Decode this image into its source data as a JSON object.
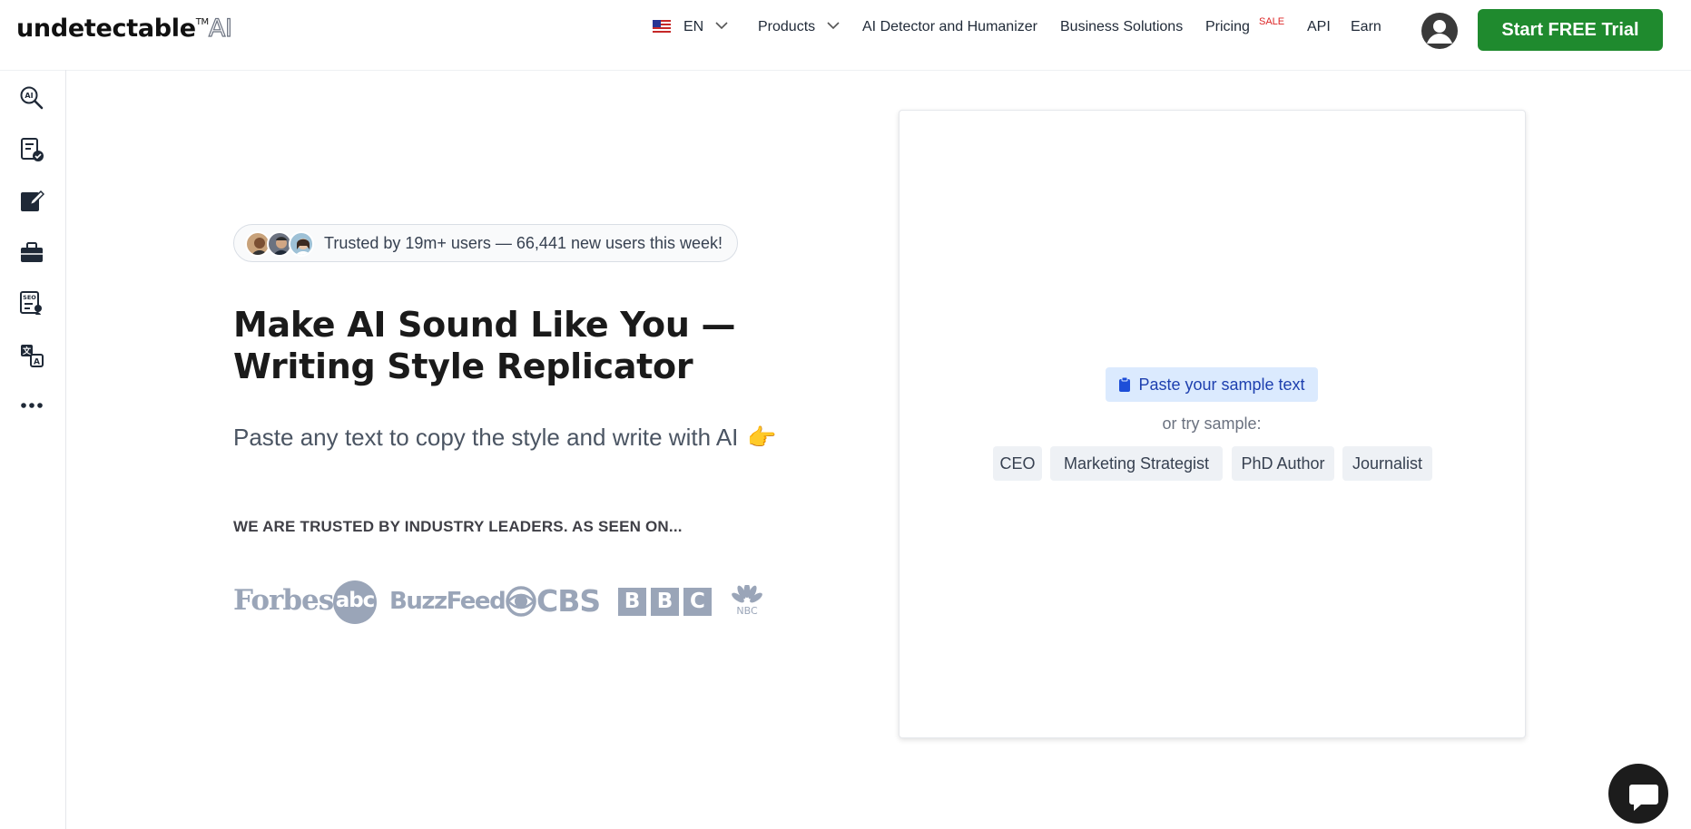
{
  "header": {
    "logo_text": "undetectable",
    "logo_tm": "TM",
    "logo_ai": "AI",
    "language": "EN",
    "nav": {
      "products": "Products",
      "detector": "AI Detector and Humanizer",
      "business": "Business Solutions",
      "pricing": "Pricing",
      "sale_badge": "SALE",
      "api": "API",
      "earn": "Earn"
    },
    "cta_label": "Start FREE Trial"
  },
  "sidebar": {
    "icons": [
      "ai-detector-icon",
      "document-check-icon",
      "edit-icon",
      "briefcase-icon",
      "seo-document-icon",
      "translate-icon",
      "more-icon"
    ]
  },
  "hero": {
    "trust_text": "Trusted by 19m+ users — 66,441 new users this week!",
    "title": "Make AI Sound Like You — Writing Style Replicator",
    "subtitle": "Paste any text to copy the style and write with AI",
    "subtitle_emoji": "👉",
    "trusted_by": "WE ARE TRUSTED BY INDUSTRY LEADERS. AS SEEN ON...",
    "brands": {
      "forbes": "Forbes",
      "abc": "abc",
      "buzzfeed": "BuzzFeed",
      "cbs": "CBS",
      "bbc": [
        "B",
        "B",
        "C"
      ],
      "nbc": "NBC"
    }
  },
  "card": {
    "paste_label": "Paste your sample text",
    "or_try": "or try sample:",
    "samples": [
      "CEO",
      "Marketing Strategist",
      "PhD Author",
      "Journalist"
    ]
  },
  "colors": {
    "cta": "#1f8a2e",
    "sale": "#dc2626",
    "paste_bg": "#dbeafe",
    "brand_gray": "#9aa5b8"
  }
}
